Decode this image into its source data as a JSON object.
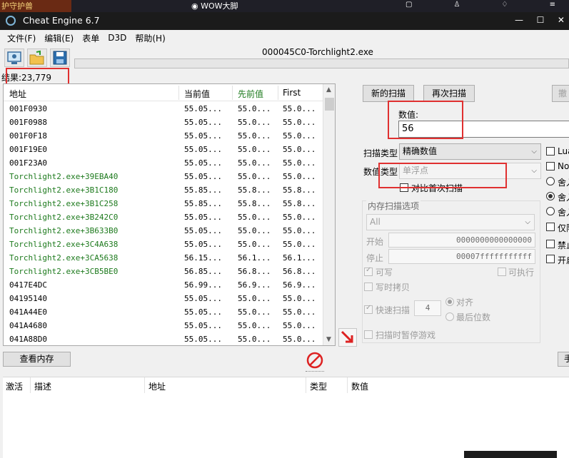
{
  "background": {
    "left_game_text": "护守护兽",
    "wow_text": "WOW大脚"
  },
  "window": {
    "title": "Cheat Engine 6.7",
    "minimize": "—",
    "maximize": "☐",
    "close": "✕"
  },
  "menu": [
    "文件(F)",
    "编辑(E)",
    "表单",
    "D3D",
    "帮助(H)"
  ],
  "toolbar": {
    "process_name": "000045C0-Torchlight2.exe",
    "icons": [
      "open-process-icon",
      "open-folder-icon",
      "save-icon"
    ]
  },
  "found": "结果:23,779",
  "results": {
    "columns": [
      "地址",
      "当前值",
      "先前值",
      "First"
    ],
    "rows": [
      {
        "addr": "001F0930",
        "cur": "55.05...",
        "prev": "55.0...",
        "first": "55.0...",
        "green": false
      },
      {
        "addr": "001F0988",
        "cur": "55.05...",
        "prev": "55.0...",
        "first": "55.0...",
        "green": false
      },
      {
        "addr": "001F0F18",
        "cur": "55.05...",
        "prev": "55.0...",
        "first": "55.0...",
        "green": false
      },
      {
        "addr": "001F19E0",
        "cur": "55.05...",
        "prev": "55.0...",
        "first": "55.0...",
        "green": false
      },
      {
        "addr": "001F23A0",
        "cur": "55.05...",
        "prev": "55.0...",
        "first": "55.0...",
        "green": false
      },
      {
        "addr": "Torchlight2.exe+39EBA40",
        "cur": "55.05...",
        "prev": "55.0...",
        "first": "55.0...",
        "green": true
      },
      {
        "addr": "Torchlight2.exe+3B1C180",
        "cur": "55.85...",
        "prev": "55.8...",
        "first": "55.8...",
        "green": true
      },
      {
        "addr": "Torchlight2.exe+3B1C258",
        "cur": "55.85...",
        "prev": "55.8...",
        "first": "55.8...",
        "green": true
      },
      {
        "addr": "Torchlight2.exe+3B242C0",
        "cur": "55.05...",
        "prev": "55.0...",
        "first": "55.0...",
        "green": true
      },
      {
        "addr": "Torchlight2.exe+3B633B0",
        "cur": "55.05...",
        "prev": "55.0...",
        "first": "55.0...",
        "green": true
      },
      {
        "addr": "Torchlight2.exe+3C4A638",
        "cur": "55.05...",
        "prev": "55.0...",
        "first": "55.0...",
        "green": true
      },
      {
        "addr": "Torchlight2.exe+3CA5638",
        "cur": "56.15...",
        "prev": "56.1...",
        "first": "56.1...",
        "green": true
      },
      {
        "addr": "Torchlight2.exe+3CB5BE0",
        "cur": "56.85...",
        "prev": "56.8...",
        "first": "56.8...",
        "green": true
      },
      {
        "addr": "0417E4DC",
        "cur": "56.99...",
        "prev": "56.9...",
        "first": "56.9...",
        "green": false
      },
      {
        "addr": "04195140",
        "cur": "55.05...",
        "prev": "55.0...",
        "first": "55.0...",
        "green": false
      },
      {
        "addr": "041A44E0",
        "cur": "55.05...",
        "prev": "55.0...",
        "first": "55.0...",
        "green": false
      },
      {
        "addr": "041A4680",
        "cur": "55.05...",
        "prev": "55.0...",
        "first": "55.0...",
        "green": false
      },
      {
        "addr": "041A88D0",
        "cur": "55.05...",
        "prev": "55.0...",
        "first": "55.0...",
        "green": false
      }
    ]
  },
  "scan": {
    "new_scan": "新的扫描",
    "next_scan": "再次扫描",
    "undo_scan": "撤",
    "value_label": "数值:",
    "value": "56",
    "scan_type_label": "扫描类型",
    "scan_type": "精确数值",
    "value_type_label": "数值类型",
    "value_type": "单浮点",
    "compare_first": "对比首次扫描"
  },
  "memory": {
    "group_label": "内存扫描选项",
    "region": "All",
    "start_label": "开始",
    "start": "0000000000000000",
    "stop_label": "停止",
    "stop": "00007fffffffffff",
    "writable": "可写",
    "executable": "可执行",
    "copy_on_write": "写时拷贝",
    "fast_scan": "快速扫描",
    "fast_scan_value": "4",
    "align": "对齐",
    "last_digits": "最后位数",
    "pause_game": "扫描时暂停游戏"
  },
  "options": {
    "lua": "Lua",
    "not": "No",
    "round1": "舍入",
    "round2": "舍入",
    "round3": "舍入",
    "only": "仅限",
    "disable": "禁止",
    "enable": "开启"
  },
  "bottom": {
    "view_memory": "查看内存",
    "add_manual": "手",
    "columns": [
      "激活",
      "描述",
      "地址",
      "类型",
      "数值"
    ]
  }
}
